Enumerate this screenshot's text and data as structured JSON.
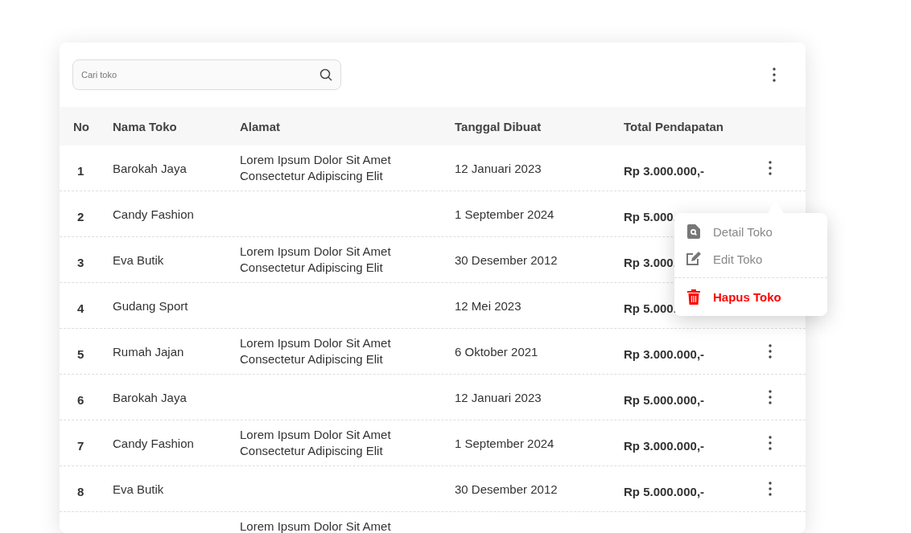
{
  "search": {
    "placeholder": "Cari toko"
  },
  "table": {
    "columns": [
      "No",
      "Nama Toko",
      "Alamat",
      "Tanggal Dibuat",
      "Total Pendapatan"
    ],
    "rows": [
      {
        "no": "1",
        "name": "Barokah Jaya",
        "address": [
          "Lorem Ipsum Dolor Sit Amet",
          "Consectetur Adipiscing Elit"
        ],
        "date": "12 Januari 2023",
        "total": "Rp 3.000.000,-",
        "menu_button": true,
        "menu": {
          "open": true,
          "items": [
            {
              "kind": "detail",
              "label": "Detail Toko"
            },
            {
              "kind": "edit",
              "label": "Edit Toko"
            },
            {
              "kind": "delete",
              "label": "Hapus Toko"
            }
          ]
        }
      },
      {
        "no": "2",
        "name": "Candy Fashion",
        "address": [],
        "date": "1 September 2024",
        "total": "Rp 5.000.",
        "menu_button": false
      },
      {
        "no": "3",
        "name": "Eva Butik",
        "address": [
          "Lorem Ipsum Dolor Sit Amet",
          "Consectetur Adipiscing Elit"
        ],
        "date": "30 Desember 2012",
        "total": "Rp 3.000.",
        "menu_button": false
      },
      {
        "no": "4",
        "name": "Gudang Sport",
        "address": [],
        "date": "12 Mei 2023",
        "total": "Rp 5.000.",
        "menu_button": false
      },
      {
        "no": "5",
        "name": "Rumah Jajan",
        "address": [
          "Lorem Ipsum Dolor Sit Amet",
          "Consectetur Adipiscing Elit"
        ],
        "date": "6 Oktober 2021",
        "total": "Rp 3.000.000,-",
        "menu_button": true
      },
      {
        "no": "6",
        "name": "Barokah Jaya",
        "address": [],
        "date": "12 Januari 2023",
        "total": "Rp 5.000.000,-",
        "menu_button": true
      },
      {
        "no": "7",
        "name": "Candy Fashion",
        "address": [
          "Lorem Ipsum Dolor Sit Amet",
          "Consectetur Adipiscing Elit"
        ],
        "date": "1 September 2024",
        "total": "Rp 3.000.000,-",
        "menu_button": true
      },
      {
        "no": "8",
        "name": "Eva Butik",
        "address": [],
        "date": "30 Desember 2012",
        "total": "Rp 5.000.000,-",
        "menu_button": true
      },
      {
        "no": "",
        "name": "",
        "address": [
          "Lorem Ipsum Dolor Sit Amet"
        ],
        "date": "",
        "total": "",
        "menu_button": false
      }
    ]
  }
}
